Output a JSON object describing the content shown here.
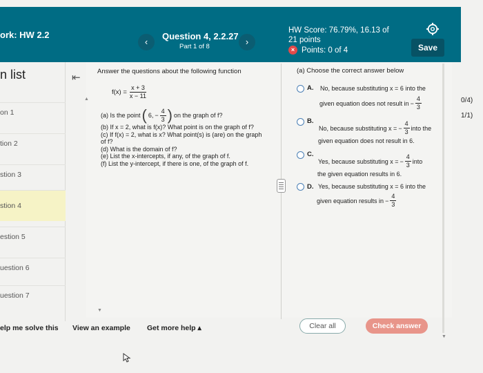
{
  "header": {
    "hw_title": "ork:  HW 2.2",
    "prev_glyph": "‹",
    "next_glyph": "›",
    "question_title": "Question 4, 2.2.27",
    "part": "Part 1 of 8",
    "score_line1": "HW Score: 76.79%, 16.13 of",
    "score_line2": "21 points",
    "points": "Points: 0 of 4",
    "points_icon": "×",
    "save_label": "Save",
    "gear_icon": "gear-icon"
  },
  "qlist": {
    "heading": "n list",
    "collapse_glyph": "⇤",
    "items": [
      {
        "label": "on 1"
      },
      {
        "label": "tion 2"
      },
      {
        "label": "stion 3"
      },
      {
        "label": "stion 4"
      },
      {
        "label": "estion 5"
      },
      {
        "label": "uestion 6"
      },
      {
        "label": "uestion 7"
      }
    ]
  },
  "right_strip": {
    "score_a": "0/4)",
    "score_b": "1/1)"
  },
  "question": {
    "instruction": "Answer the questions about the following function",
    "func_prefix": "f(x) =",
    "func_num": "x + 3",
    "func_den": "x − 11",
    "part_a_prefix": "(a) Is the point",
    "part_a_point_x": "6,",
    "part_a_neg": "−",
    "part_a_num": "4",
    "part_a_den": "3",
    "part_a_suffix": "on the graph of f?",
    "part_b": "(b) If x = 2, what is f(x)? What point is on the graph of f?",
    "part_c": "(c) If f(x) = 2, what is x? What point(s) is (are) on the graph of f?",
    "part_d": "(d) What is the domain of f?",
    "part_e": "(e) List the x-intercepts, if any, of the graph of f.",
    "part_f": "(f) List the y-intercept, if there is one, of the graph of f."
  },
  "answer": {
    "title": "(a) Choose the correct answer below",
    "choices": [
      {
        "letter": "A.",
        "line1": "No, because substituting x = 6 into the",
        "line2_pre": "given equation does not result in",
        "line2_neg": "−",
        "num": "4",
        "den": "3"
      },
      {
        "letter": "B.",
        "line1_pre": "No, because substituting x =",
        "line1_neg": "−",
        "num": "4",
        "den": "3",
        "line1_post": "into the",
        "line2": "given equation does not result in 6."
      },
      {
        "letter": "C.",
        "line1_pre": "Yes, because substituting x =",
        "line1_neg": "−",
        "num": "4",
        "den": "3",
        "line1_post": "into",
        "line2": "the given equation results in 6."
      },
      {
        "letter": "D.",
        "line1": "Yes, because substituting x = 6 into the",
        "line2_pre": "given equation results in",
        "line2_neg": "−",
        "num": "4",
        "den": "3"
      }
    ]
  },
  "footer": {
    "help": "elp me solve this",
    "example": "View an example",
    "more_help": "Get more help ▴",
    "clear": "Clear all",
    "check": "Check answer"
  }
}
